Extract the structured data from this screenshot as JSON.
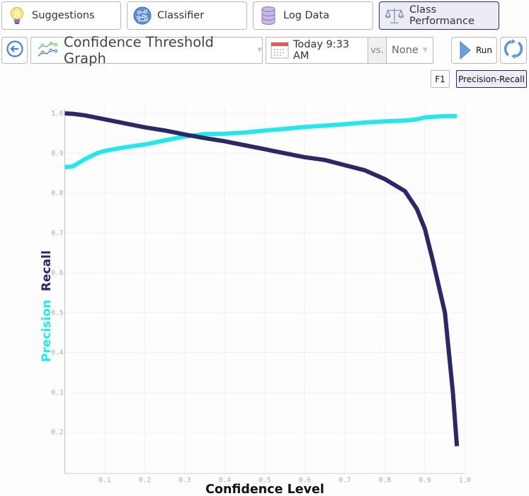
{
  "nav": {
    "tabs": [
      {
        "label": "Suggestions",
        "icon": "lightbulb-icon"
      },
      {
        "label": "Classifier",
        "icon": "circuit-icon"
      },
      {
        "label": "Log Data",
        "icon": "database-icon"
      },
      {
        "label": "Class Performance",
        "icon": "scales-icon",
        "active": true
      }
    ]
  },
  "toolbar": {
    "back_icon": "back-arrow-icon",
    "graph_select": {
      "value": "Confidence Threshold Graph",
      "icon": "line-graph-icon"
    },
    "date_select": {
      "value": "Today 9:33 AM",
      "icon": "calendar-icon"
    },
    "vs_label": "vs.",
    "compare_select": {
      "value": "None"
    },
    "run_label": "Run",
    "refresh_icon": "refresh-icon"
  },
  "metric_toggle": {
    "options": [
      {
        "label": "F1",
        "active": false
      },
      {
        "label": "Precision-Recall",
        "active": true
      }
    ]
  },
  "colors": {
    "precision": "#22e8ec",
    "recall": "#2b2866",
    "active_border": "#2d2a5e",
    "axis_tick": "#aaaaaa"
  },
  "chart_data": {
    "type": "line",
    "title": "",
    "xlabel": "Confidence Level",
    "ylabel_parts": [
      {
        "text": "Precision",
        "series": "Precision"
      },
      {
        "text": "Recall",
        "series": "Recall"
      }
    ],
    "xlim": [
      0.0,
      1.0
    ],
    "ylim": [
      0.1,
      1.0
    ],
    "x_ticks": [
      "0.1",
      "0.2",
      "0.3",
      "0.4",
      "0.5",
      "0.6",
      "0.7",
      "0.8",
      "0.9",
      "1.0"
    ],
    "y_ticks": [
      "0.2",
      "0.3",
      "0.4",
      "0.5",
      "0.6",
      "0.7",
      "0.8",
      "0.9",
      "1.0"
    ],
    "grid": true,
    "series": [
      {
        "name": "Precision",
        "x": [
          0.0,
          0.02,
          0.05,
          0.08,
          0.1,
          0.15,
          0.2,
          0.25,
          0.3,
          0.35,
          0.4,
          0.45,
          0.5,
          0.55,
          0.6,
          0.65,
          0.7,
          0.75,
          0.8,
          0.85,
          0.88,
          0.9,
          0.93,
          0.95,
          0.98
        ],
        "y": [
          0.865,
          0.867,
          0.885,
          0.9,
          0.906,
          0.915,
          0.922,
          0.932,
          0.942,
          0.948,
          0.949,
          0.952,
          0.957,
          0.961,
          0.966,
          0.969,
          0.973,
          0.977,
          0.98,
          0.982,
          0.985,
          0.99,
          0.992,
          0.993,
          0.993
        ]
      },
      {
        "name": "Recall",
        "x": [
          0.0,
          0.02,
          0.05,
          0.1,
          0.15,
          0.2,
          0.25,
          0.3,
          0.35,
          0.4,
          0.45,
          0.5,
          0.55,
          0.6,
          0.65,
          0.7,
          0.75,
          0.8,
          0.85,
          0.88,
          0.9,
          0.92,
          0.95,
          0.97,
          0.98
        ],
        "y": [
          1.0,
          0.999,
          0.995,
          0.985,
          0.975,
          0.965,
          0.957,
          0.947,
          0.938,
          0.93,
          0.92,
          0.91,
          0.9,
          0.89,
          0.883,
          0.87,
          0.857,
          0.835,
          0.805,
          0.76,
          0.71,
          0.63,
          0.5,
          0.3,
          0.165
        ]
      }
    ]
  }
}
